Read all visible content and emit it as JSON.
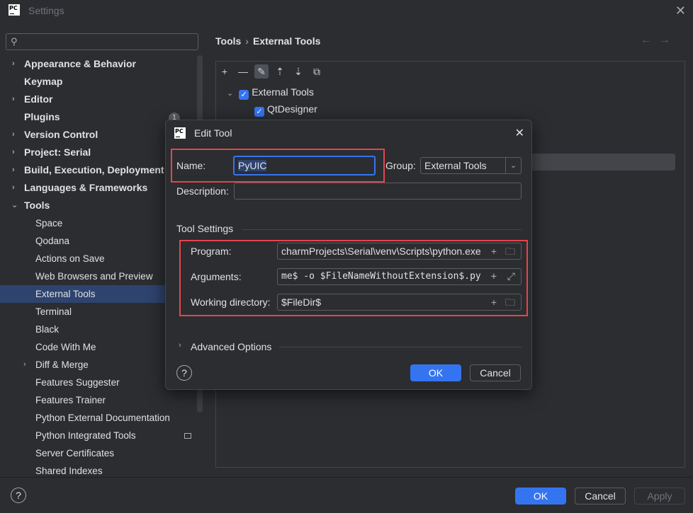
{
  "window": {
    "title": "Settings",
    "logo": "PC"
  },
  "sidebar": {
    "search_placeholder": "",
    "badge": "1",
    "items": [
      {
        "label": "Appearance & Behavior",
        "arrow": "›"
      },
      {
        "label": "Keymap"
      },
      {
        "label": "Editor",
        "arrow": "›"
      },
      {
        "label": "Plugins"
      },
      {
        "label": "Version Control",
        "arrow": "›"
      },
      {
        "label": "Project: Serial",
        "arrow": "›"
      },
      {
        "label": "Build, Execution, Deployment",
        "arrow": "›"
      },
      {
        "label": "Languages & Frameworks",
        "arrow": "›"
      },
      {
        "label": "Tools",
        "arrow": "⌄"
      },
      {
        "label": "Space"
      },
      {
        "label": "Qodana"
      },
      {
        "label": "Actions on Save"
      },
      {
        "label": "Web Browsers and Preview"
      },
      {
        "label": "External Tools"
      },
      {
        "label": "Terminal"
      },
      {
        "label": "Black"
      },
      {
        "label": "Code With Me"
      },
      {
        "label": "Diff & Merge",
        "arrow": "›"
      },
      {
        "label": "Features Suggester"
      },
      {
        "label": "Features Trainer"
      },
      {
        "label": "Python External Documentation"
      },
      {
        "label": "Python Integrated Tools"
      },
      {
        "label": "Server Certificates"
      },
      {
        "label": "Shared Indexes"
      }
    ]
  },
  "main": {
    "breadcrumb": [
      "Tools",
      "External Tools"
    ],
    "nav_back": "←",
    "nav_forward": "→",
    "tree": {
      "group_label": "External Tools",
      "child_label": "QtDesigner"
    }
  },
  "dialog": {
    "title": "Edit Tool",
    "logo": "PC",
    "name_label": "Name:",
    "name_value": "PyUIC",
    "group_label": "Group:",
    "group_value": "External Tools",
    "description_label": "Description:",
    "description_value": "",
    "section_title": "Tool Settings",
    "program_label": "Program:",
    "program_value": "charmProjects\\Serial\\venv\\Scripts\\python.exe",
    "arguments_label": "Arguments:",
    "arguments_value": "me$ -o $FileNameWithoutExtension$.py",
    "workdir_label": "Working directory:",
    "workdir_value": "$FileDir$",
    "advanced_label": "Advanced Options",
    "help": "?",
    "ok": "OK",
    "cancel": "Cancel"
  },
  "footer": {
    "help": "?",
    "ok": "OK",
    "cancel": "Cancel",
    "apply": "Apply"
  },
  "colors": {
    "accent": "#3574f0",
    "selection": "#2e436e",
    "highlight_box": "#e5444c",
    "background": "#2b2d30"
  }
}
